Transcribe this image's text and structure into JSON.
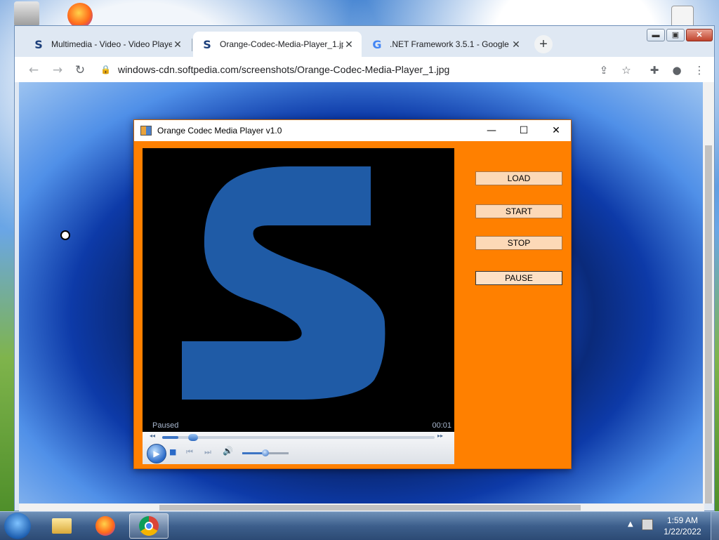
{
  "browser": {
    "tabs": [
      {
        "title": "Multimedia - Video - Video Playe",
        "favicon": "softpedia-s-icon",
        "close": "✕",
        "active": false
      },
      {
        "title": "Orange-Codec-Media-Player_1.jp",
        "favicon": "softpedia-s-icon",
        "close": "✕",
        "active": true
      },
      {
        "title": ".NET Framework 3.5.1 - Google S",
        "favicon": "google-g-icon",
        "close": "✕",
        "active": false
      }
    ],
    "new_tab_label": "+",
    "window_controls": {
      "minimize": "▬",
      "maximize": "▣",
      "close": "✕"
    },
    "url": "windows-cdn.softpedia.com/screenshots/Orange-Codec-Media-Player_1.jpg",
    "icons": {
      "back": "←",
      "forward": "→",
      "reload": "↻",
      "share": "⇪",
      "bookmark": "☆",
      "extensions": "✚",
      "profile": "●",
      "menu": "⋮",
      "lock": "🔒"
    }
  },
  "player": {
    "title": "Orange Codec Media Player v1.0",
    "window_controls": {
      "minimize": "—",
      "maximize": "☐",
      "close": "✕"
    },
    "status": "Paused",
    "time": "00:01",
    "seek_progress": 0.06,
    "volume": 0.5,
    "buttons": {
      "load": "LOAD",
      "start": "START",
      "stop": "STOP",
      "pause": "PAUSE"
    },
    "controls": {
      "rewind": "◂◂",
      "fast_forward": "▸▸",
      "play": "▶",
      "stop": "■",
      "previous": "⏮",
      "next": "⏭",
      "volume": "🔊"
    },
    "colors": {
      "frame": "#ff8000",
      "button": "#fcd9b7",
      "video_bg": "#000000",
      "logo": "#1f5ba6"
    }
  },
  "taskbar": {
    "clock_time": "1:59 AM",
    "clock_date": "1/22/2022",
    "tray_expand": "▲"
  }
}
